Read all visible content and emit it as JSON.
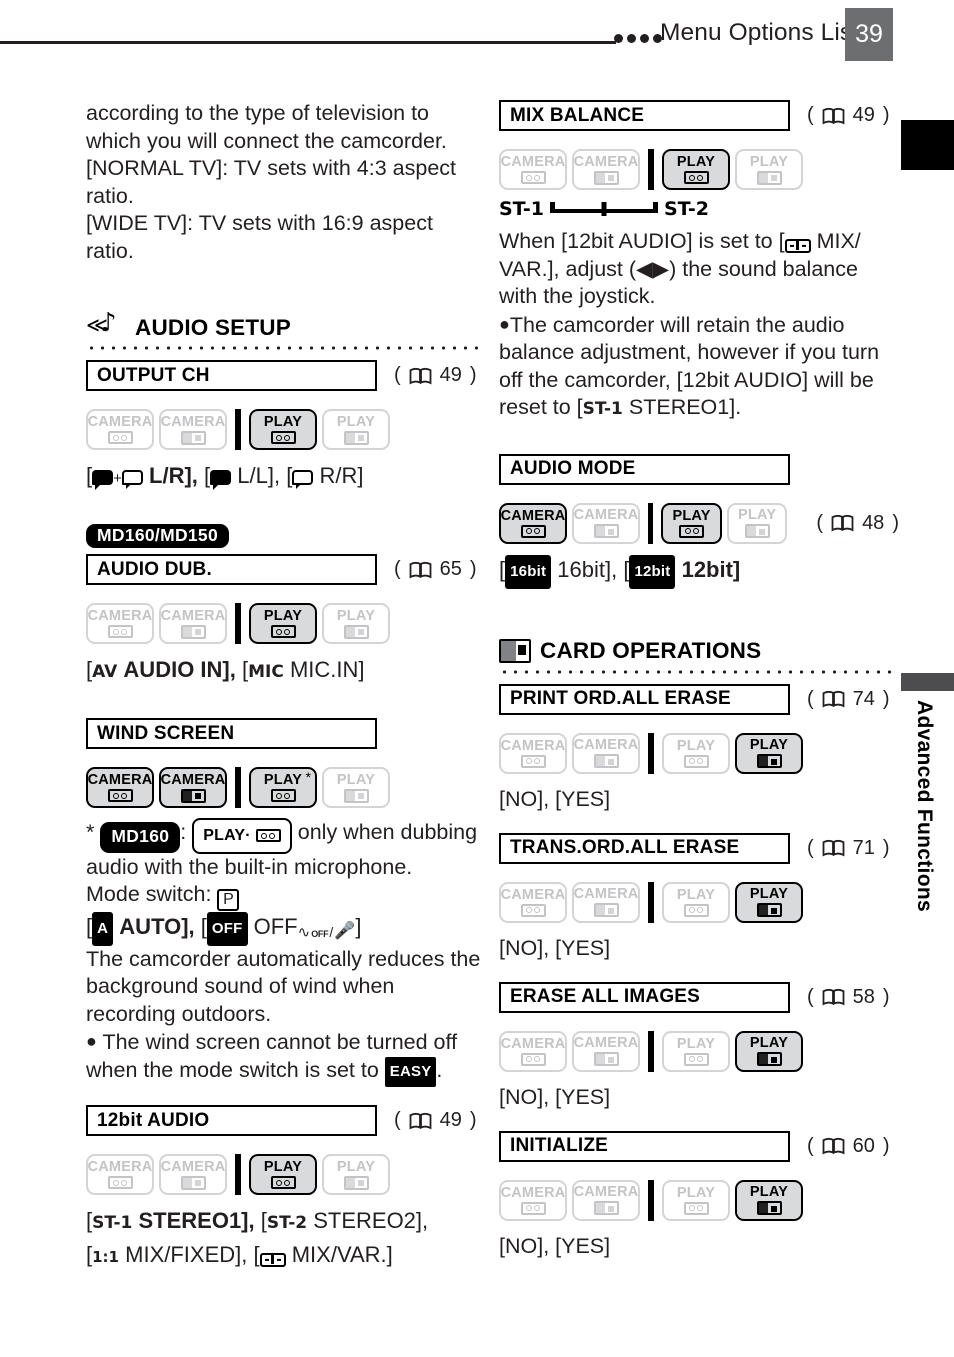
{
  "header": {
    "title": "Menu Options Lists",
    "page_number": "39",
    "dots_count": 4
  },
  "edge_tab": {
    "label": "Advanced Functions"
  },
  "left_column": {
    "intro_paragraphs": [
      "according to the type of television to which you will connect the camcorder.",
      "[NORMAL TV]: TV sets with 4:3 aspect ratio.",
      "[WIDE TV]: TV sets with 16:9 aspect ratio."
    ],
    "section": {
      "title": "AUDIO SETUP",
      "icon": "audio-note-icon"
    },
    "items": [
      {
        "name": "OUTPUT CH",
        "page_ref": "49",
        "badges": [
          {
            "label": "CAMERA",
            "glyph": "tape",
            "state": "off"
          },
          {
            "label": "CAMERA",
            "glyph": "card",
            "state": "off"
          },
          {
            "label": "PLAY",
            "glyph": "tape",
            "state": "on"
          },
          {
            "label": "PLAY",
            "glyph": "card",
            "state": "off"
          }
        ],
        "options_text": {
          "o1": "L/R],",
          "o2": "L/L],",
          "o3": "R/R]"
        }
      },
      {
        "model_tag": "MD160/MD150",
        "name": "AUDIO DUB.",
        "page_ref": "65",
        "badges": [
          {
            "label": "CAMERA",
            "glyph": "tape",
            "state": "off"
          },
          {
            "label": "CAMERA",
            "glyph": "card",
            "state": "off"
          },
          {
            "label": "PLAY",
            "glyph": "tape",
            "state": "on"
          },
          {
            "label": "PLAY",
            "glyph": "card",
            "state": "off"
          }
        ],
        "options_text": {
          "tag1": "AV",
          "o1": "AUDIO IN],",
          "tag2": "MIC",
          "o2": "MIC.IN]"
        }
      },
      {
        "name": "WIND SCREEN",
        "page_ref": "",
        "badges": [
          {
            "label": "CAMERA",
            "glyph": "tape",
            "state": "on"
          },
          {
            "label": "CAMERA",
            "glyph": "card",
            "state": "on"
          },
          {
            "label": "PLAY",
            "glyph": "tape",
            "state": "on",
            "star": "*"
          },
          {
            "label": "PLAY",
            "glyph": "card",
            "state": "off"
          }
        ],
        "footnote": {
          "star": "*",
          "model": "MD160",
          "colon": ":",
          "chip_label": "PLAY·",
          "text": "only when dubbing audio with the built-in microphone."
        },
        "mode_switch_label": "Mode switch:",
        "mode_switch_value": "P",
        "options_text": {
          "tag1": "A",
          "o1": "AUTO],",
          "tag2": "OFF",
          "o2": "OFF"
        },
        "description": "The camcorder automatically reduces the background sound of wind when recording outdoors.",
        "note_bullet": "●",
        "note": "The wind screen cannot be turned off when the mode switch is set to",
        "note_tag": "EASY",
        "note_end": "."
      },
      {
        "name": "12bit AUDIO",
        "page_ref": "49",
        "badges": [
          {
            "label": "CAMERA",
            "glyph": "tape",
            "state": "off"
          },
          {
            "label": "CAMERA",
            "glyph": "card",
            "state": "off"
          },
          {
            "label": "PLAY",
            "glyph": "tape",
            "state": "on"
          },
          {
            "label": "PLAY",
            "glyph": "card",
            "state": "off"
          }
        ],
        "options_text": {
          "t1": "ST-1",
          "o1": "STEREO1],",
          "t2": "ST-2",
          "o2": "STEREO2],",
          "t3": "1:1",
          "o3": "MIX/FIXED],",
          "o4": "MIX/VAR.]"
        }
      }
    ]
  },
  "right_column": {
    "items": [
      {
        "name": "MIX BALANCE",
        "page_ref": "49",
        "badges": [
          {
            "label": "CAMERA",
            "glyph": "tape",
            "state": "off"
          },
          {
            "label": "CAMERA",
            "glyph": "card",
            "state": "off"
          },
          {
            "label": "PLAY",
            "glyph": "tape",
            "state": "on"
          },
          {
            "label": "PLAY",
            "glyph": "card",
            "state": "off"
          }
        ],
        "mix_left": "ST-1",
        "mix_right": "ST-2",
        "body1_a": "When [12bit AUDIO] is set to [",
        "body1_b": "MIX/ VAR.], adjust (",
        "body1_arrows": "◀▶",
        "body1_c": ") the sound balance with the joystick.",
        "note_bullet": "●",
        "note_a": "The camcorder will retain the audio balance adjustment, however if you turn off the camcorder, [12bit AUDIO] will be reset to [",
        "note_tag": "ST-1",
        "note_b": "STEREO1]."
      },
      {
        "name": "AUDIO MODE",
        "page_ref": "48",
        "page_ref_position": "after-badges",
        "badges": [
          {
            "label": "CAMERA",
            "glyph": "tape",
            "state": "on"
          },
          {
            "label": "CAMERA",
            "glyph": "card",
            "state": "off"
          },
          {
            "label": "PLAY",
            "glyph": "tape",
            "state": "on"
          },
          {
            "label": "PLAY",
            "glyph": "card",
            "state": "off"
          }
        ],
        "options_text": {
          "tag1": "16bit",
          "o1": "16bit],",
          "tag2": "12bit",
          "o2": "12bit]"
        }
      }
    ],
    "section": {
      "title": "CARD OPERATIONS",
      "icon": "memory-card-icon"
    },
    "card_items": [
      {
        "name": "PRINT ORD.ALL ERASE",
        "page_ref": "74",
        "badges": [
          {
            "label": "CAMERA",
            "glyph": "tape",
            "state": "off"
          },
          {
            "label": "CAMERA",
            "glyph": "card",
            "state": "off"
          },
          {
            "label": "PLAY",
            "glyph": "tape",
            "state": "off"
          },
          {
            "label": "PLAY",
            "glyph": "card",
            "state": "on"
          }
        ],
        "options": "[NO], [YES]"
      },
      {
        "name": "TRANS.ORD.ALL ERASE",
        "page_ref": "71",
        "badges": [
          {
            "label": "CAMERA",
            "glyph": "tape",
            "state": "off"
          },
          {
            "label": "CAMERA",
            "glyph": "card",
            "state": "off"
          },
          {
            "label": "PLAY",
            "glyph": "tape",
            "state": "off"
          },
          {
            "label": "PLAY",
            "glyph": "card",
            "state": "on"
          }
        ],
        "options": "[NO], [YES]"
      },
      {
        "name": "ERASE ALL IMAGES",
        "page_ref": "58",
        "badges": [
          {
            "label": "CAMERA",
            "glyph": "tape",
            "state": "off"
          },
          {
            "label": "CAMERA",
            "glyph": "card",
            "state": "off"
          },
          {
            "label": "PLAY",
            "glyph": "tape",
            "state": "off"
          },
          {
            "label": "PLAY",
            "glyph": "card",
            "state": "on"
          }
        ],
        "options": "[NO], [YES]"
      },
      {
        "name": "INITIALIZE",
        "page_ref": "60",
        "badges": [
          {
            "label": "CAMERA",
            "glyph": "tape",
            "state": "off"
          },
          {
            "label": "CAMERA",
            "glyph": "card",
            "state": "off"
          },
          {
            "label": "PLAY",
            "glyph": "tape",
            "state": "off"
          },
          {
            "label": "PLAY",
            "glyph": "card",
            "state": "on"
          }
        ],
        "options": "[NO], [YES]"
      }
    ]
  },
  "colors": {
    "page_tab_gray": "#6d6e70",
    "edge_tab_black": "#000000",
    "edge_bar_gray": "#4d4d4f",
    "badge_on_fill": "#d9dadb",
    "badge_off_border": "#d3d4d6",
    "text": "#231f20"
  }
}
